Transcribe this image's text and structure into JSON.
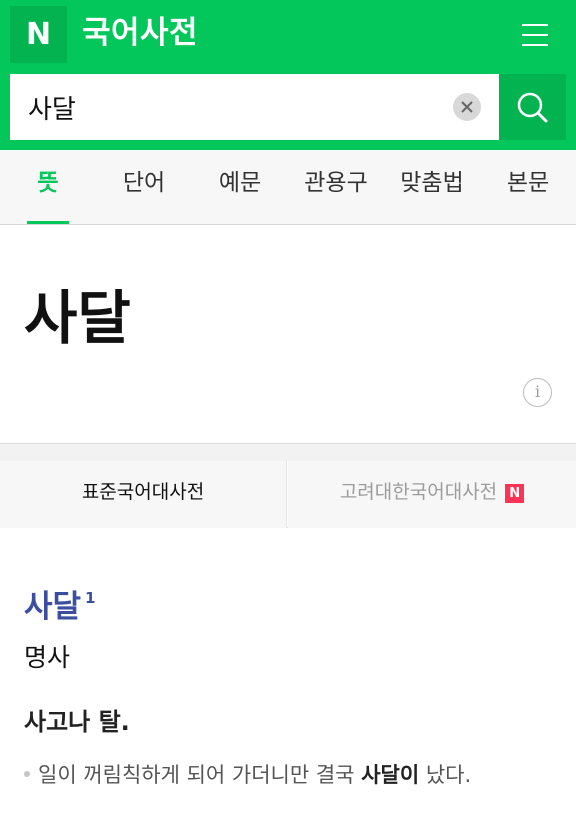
{
  "header": {
    "logo_letter": "N",
    "title": "국어사전",
    "brand_color": "#03c75a",
    "menu_icon": "hamburger-icon"
  },
  "search": {
    "value": "사달",
    "clear_icon": "close-icon",
    "search_icon": "search-icon"
  },
  "tabs": [
    {
      "label": "뜻",
      "active": true
    },
    {
      "label": "단어",
      "active": false
    },
    {
      "label": "예문",
      "active": false
    },
    {
      "label": "관용구",
      "active": false
    },
    {
      "label": "맞춤법",
      "active": false
    },
    {
      "label": "본문",
      "active": false
    }
  ],
  "entry": {
    "title": "사달",
    "info_icon": "info-icon",
    "info_glyph": "i"
  },
  "dictionaries": [
    {
      "label": "표준국어대사전",
      "active": true
    },
    {
      "label": "고려대한국어대사전",
      "active": false,
      "badge": "N",
      "badge_color": "#ff3355"
    }
  ],
  "definition": {
    "word": "사달",
    "homonym_number": "1",
    "word_color": "#3b4e9f",
    "part_of_speech": "명사",
    "meaning": "사고나 탈.",
    "example": {
      "before": "일이 꺼림칙하게 되어 가더니만 결국 ",
      "highlight": "사달이",
      "after": " 났다."
    }
  }
}
